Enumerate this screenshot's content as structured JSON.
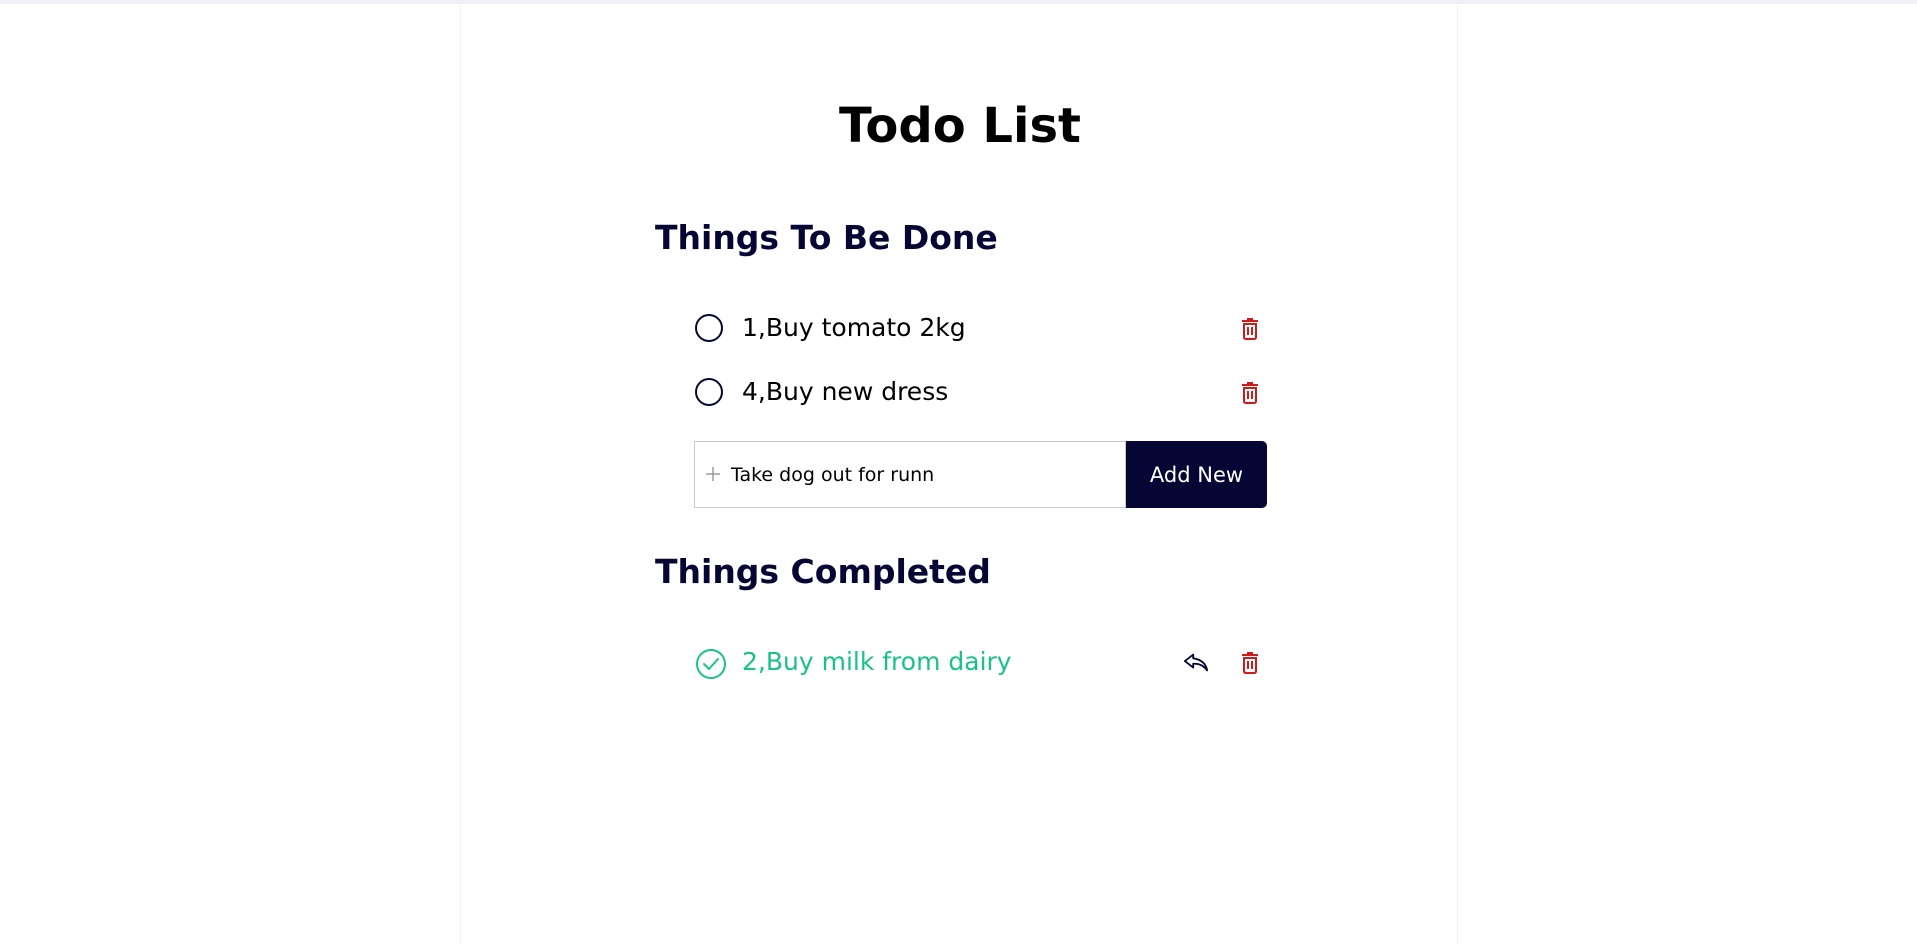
{
  "theme": {
    "navy": "#060634",
    "green": "#19c28a",
    "danger": "#cc1b1b"
  },
  "app": {
    "title": "Todo List"
  },
  "todo_section": {
    "title": "Things To Be Done",
    "items": [
      {
        "label": "1,Buy tomato 2kg",
        "done": false,
        "icon": "circle-icon",
        "action_icon": "trash-icon"
      },
      {
        "label": "4,Buy new dress",
        "done": false,
        "icon": "circle-icon",
        "action_icon": "trash-icon"
      }
    ]
  },
  "add_form": {
    "icon": "plus-icon",
    "input_value": "Take dog out for runn",
    "button_label": "Add New"
  },
  "completed_section": {
    "title": "Things Completed",
    "items": [
      {
        "label": "2,Buy milk from dairy",
        "done": true,
        "icon": "check-circle-icon",
        "action_icons": [
          "undo-icon",
          "trash-icon"
        ]
      }
    ]
  }
}
